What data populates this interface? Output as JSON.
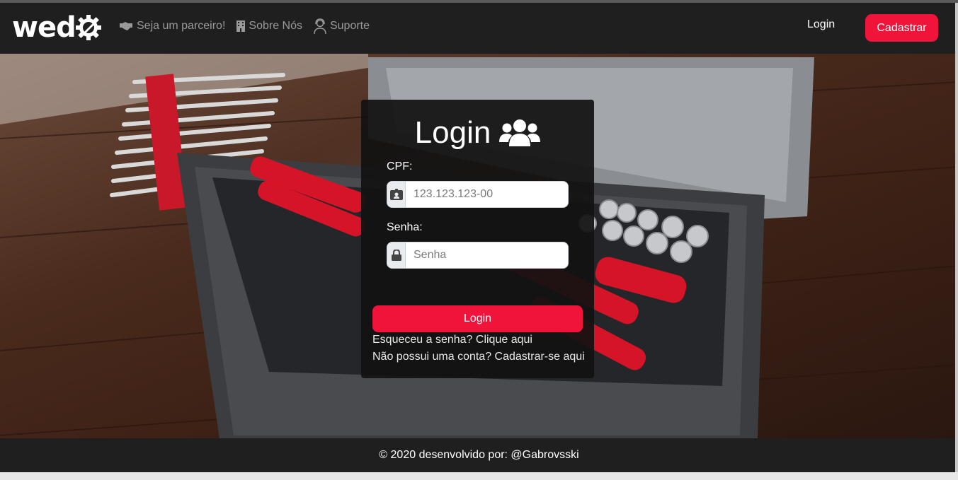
{
  "brand": {
    "logo_text": "wed"
  },
  "nav": {
    "links": [
      {
        "label": "Seja um parceiro!",
        "icon": "handshake-icon"
      },
      {
        "label": "Sobre Nós",
        "icon": "building-icon"
      },
      {
        "label": "Suporte",
        "icon": "support-agent-icon"
      }
    ],
    "login_label": "Login",
    "signup_label": "Cadastrar"
  },
  "login_card": {
    "title": "Login",
    "title_icon": "users-icon",
    "cpf": {
      "label": "CPF:",
      "placeholder": "123.123.123-00",
      "icon": "id-badge-icon"
    },
    "password": {
      "label": "Senha:",
      "placeholder": "Senha",
      "icon": "lock-icon"
    },
    "submit_label": "Login",
    "forgot_link": "Esqueceu a senha? Clique aqui",
    "register_link": "Não possui uma conta? Cadastrar-se aqui"
  },
  "footer": {
    "text": "© 2020 desenvolvido por: @Gabrovsski"
  },
  "colors": {
    "accent": "#f0133a",
    "navbar": "#1f1f1f",
    "card": "#121212"
  }
}
